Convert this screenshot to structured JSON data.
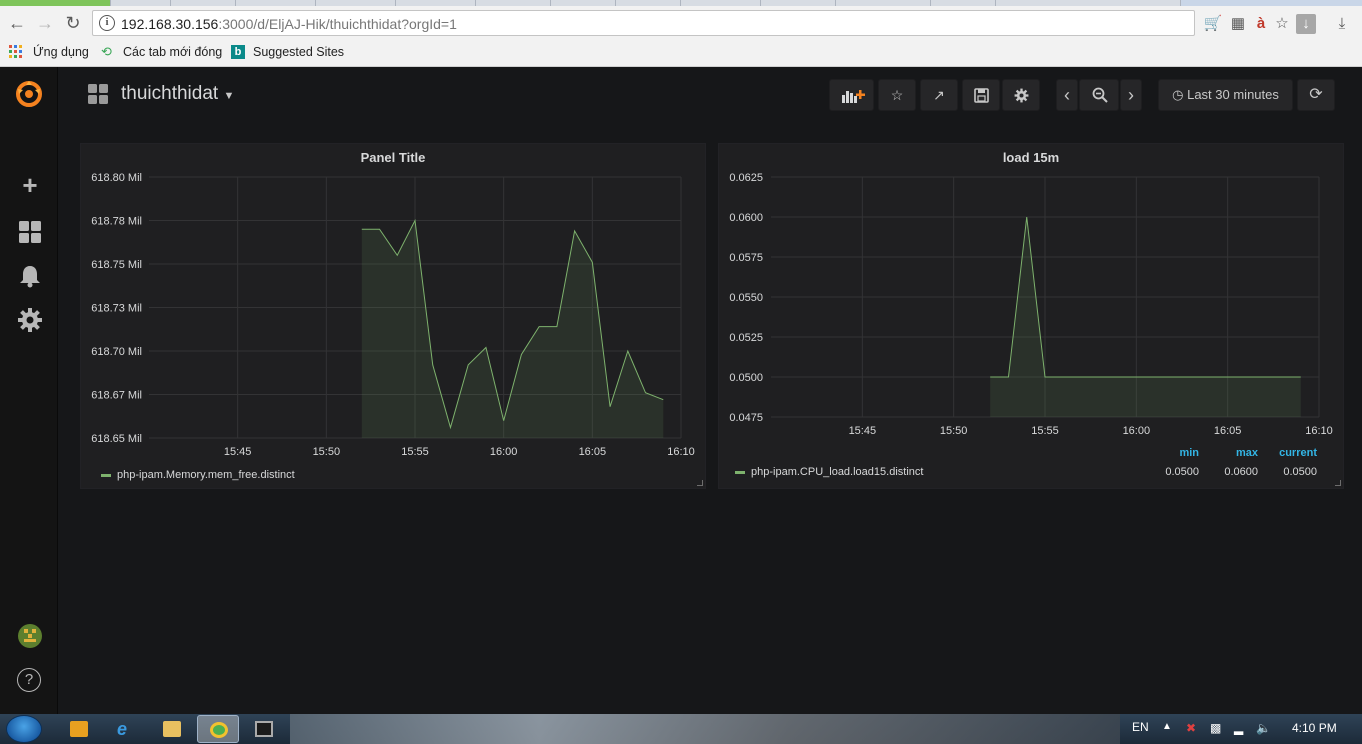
{
  "browser": {
    "url_host": "192.168.30.156",
    "url_rest": ":3000/d/EljAJ-Hik/thuichthidat?orgId=1",
    "bookmarks": [
      {
        "label": "Ứng dụng"
      },
      {
        "label": "Các tab mới đóng"
      },
      {
        "label": "Suggested Sites"
      }
    ]
  },
  "dashboard": {
    "title": "thuichthidat",
    "time_range": "Last 30 minutes"
  },
  "panels": [
    {
      "title": "Panel Title",
      "legend": [
        "php-ipam.Memory.mem_free.distinct"
      ]
    },
    {
      "title": "load 15m",
      "legend": [
        "php-ipam.CPU_load.load15.distinct"
      ],
      "legend_headers": [
        "min",
        "max",
        "current"
      ],
      "legend_values": [
        "0.0500",
        "0.0600",
        "0.0500"
      ]
    }
  ],
  "colors": {
    "series": "#7eb26d",
    "legend_header": "#33b5e5",
    "background": "#161719",
    "panel": "#1f1f21"
  },
  "taskbar": {
    "language": "EN",
    "clock": "4:10 PM"
  },
  "chart_data": [
    {
      "type": "area",
      "title": "Panel Title",
      "x": [
        "15:52",
        "15:53",
        "15:54",
        "15:55",
        "15:56",
        "15:57",
        "15:58",
        "15:59",
        "16:00",
        "16:01",
        "16:02",
        "16:03",
        "16:04",
        "16:05",
        "16:06",
        "16:07",
        "16:08",
        "16:09"
      ],
      "x_tick_labels": [
        "15:45",
        "15:50",
        "15:55",
        "16:00",
        "16:05",
        "16:10"
      ],
      "y_tick_labels": [
        "618.80 Mil",
        "618.78 Mil",
        "618.75 Mil",
        "618.73 Mil",
        "618.70 Mil",
        "618.67 Mil",
        "618.65 Mil"
      ],
      "ylim": [
        618.65,
        618.8
      ],
      "series": [
        {
          "name": "php-ipam.Memory.mem_free.distinct",
          "values": [
            618.77,
            618.77,
            618.755,
            618.775,
            618.692,
            618.656,
            618.692,
            618.702,
            618.66,
            618.698,
            618.714,
            618.714,
            618.769,
            618.751,
            618.668,
            618.7,
            618.676,
            618.672
          ]
        }
      ],
      "grid": true,
      "legend_position": "bottom-left"
    },
    {
      "type": "area",
      "title": "load 15m",
      "x": [
        "15:52",
        "15:53",
        "15:54",
        "15:55",
        "15:56",
        "15:57",
        "15:58",
        "15:59",
        "16:00",
        "16:01",
        "16:02",
        "16:03",
        "16:04",
        "16:05",
        "16:06",
        "16:07",
        "16:08",
        "16:09"
      ],
      "x_tick_labels": [
        "15:45",
        "15:50",
        "15:55",
        "16:00",
        "16:05",
        "16:10"
      ],
      "y_tick_labels": [
        "0.0625",
        "0.0600",
        "0.0575",
        "0.0550",
        "0.0525",
        "0.0500",
        "0.0475"
      ],
      "ylim": [
        0.0475,
        0.0625
      ],
      "series": [
        {
          "name": "php-ipam.CPU_load.load15.distinct",
          "values": [
            0.05,
            0.05,
            0.06,
            0.05,
            0.05,
            0.05,
            0.05,
            0.05,
            0.05,
            0.05,
            0.05,
            0.05,
            0.05,
            0.05,
            0.05,
            0.05,
            0.05,
            0.05
          ]
        }
      ],
      "grid": true,
      "legend_position": "bottom"
    }
  ]
}
